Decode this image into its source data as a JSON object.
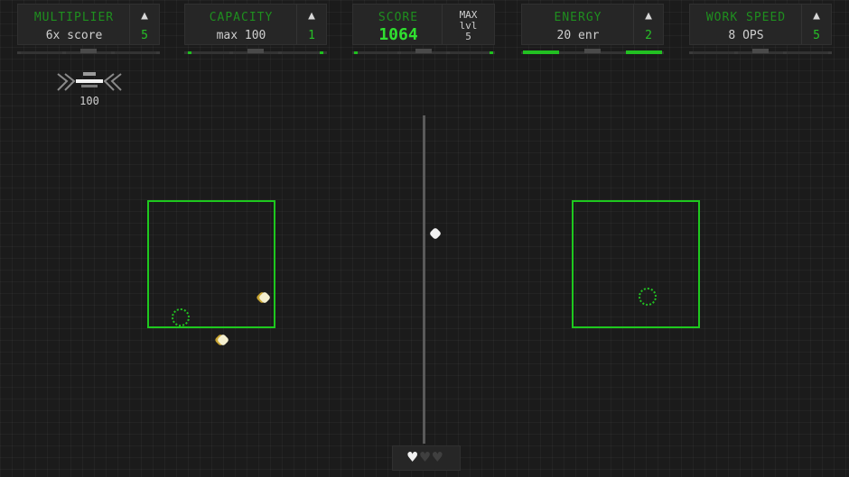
{
  "hud": {
    "upgrades": [
      {
        "title": "MULTIPLIER",
        "value": "6x score",
        "level": "5"
      },
      {
        "title": "CAPACITY",
        "value": "max 100",
        "level": "1"
      },
      {
        "title": "ENERGY",
        "value": "20 enr",
        "level": "2"
      },
      {
        "title": "WORK SPEED",
        "value": "8 OPS",
        "level": "5"
      }
    ],
    "score": {
      "title": "SCORE",
      "value": "1064",
      "max_label": "MAX",
      "max_line2": "lvl",
      "max_level": "5"
    }
  },
  "turret": {
    "label": "100"
  },
  "lives": {
    "total": 3,
    "remaining": 1
  },
  "colors": {
    "accent_green": "#1ec81e",
    "dim_green": "#1f8f1f",
    "background": "#1b1b1b",
    "panel": "#262626"
  },
  "icons": {
    "upgrade": "up-arrow-icon",
    "turret": "turret-icon",
    "heart": "heart-icon"
  }
}
